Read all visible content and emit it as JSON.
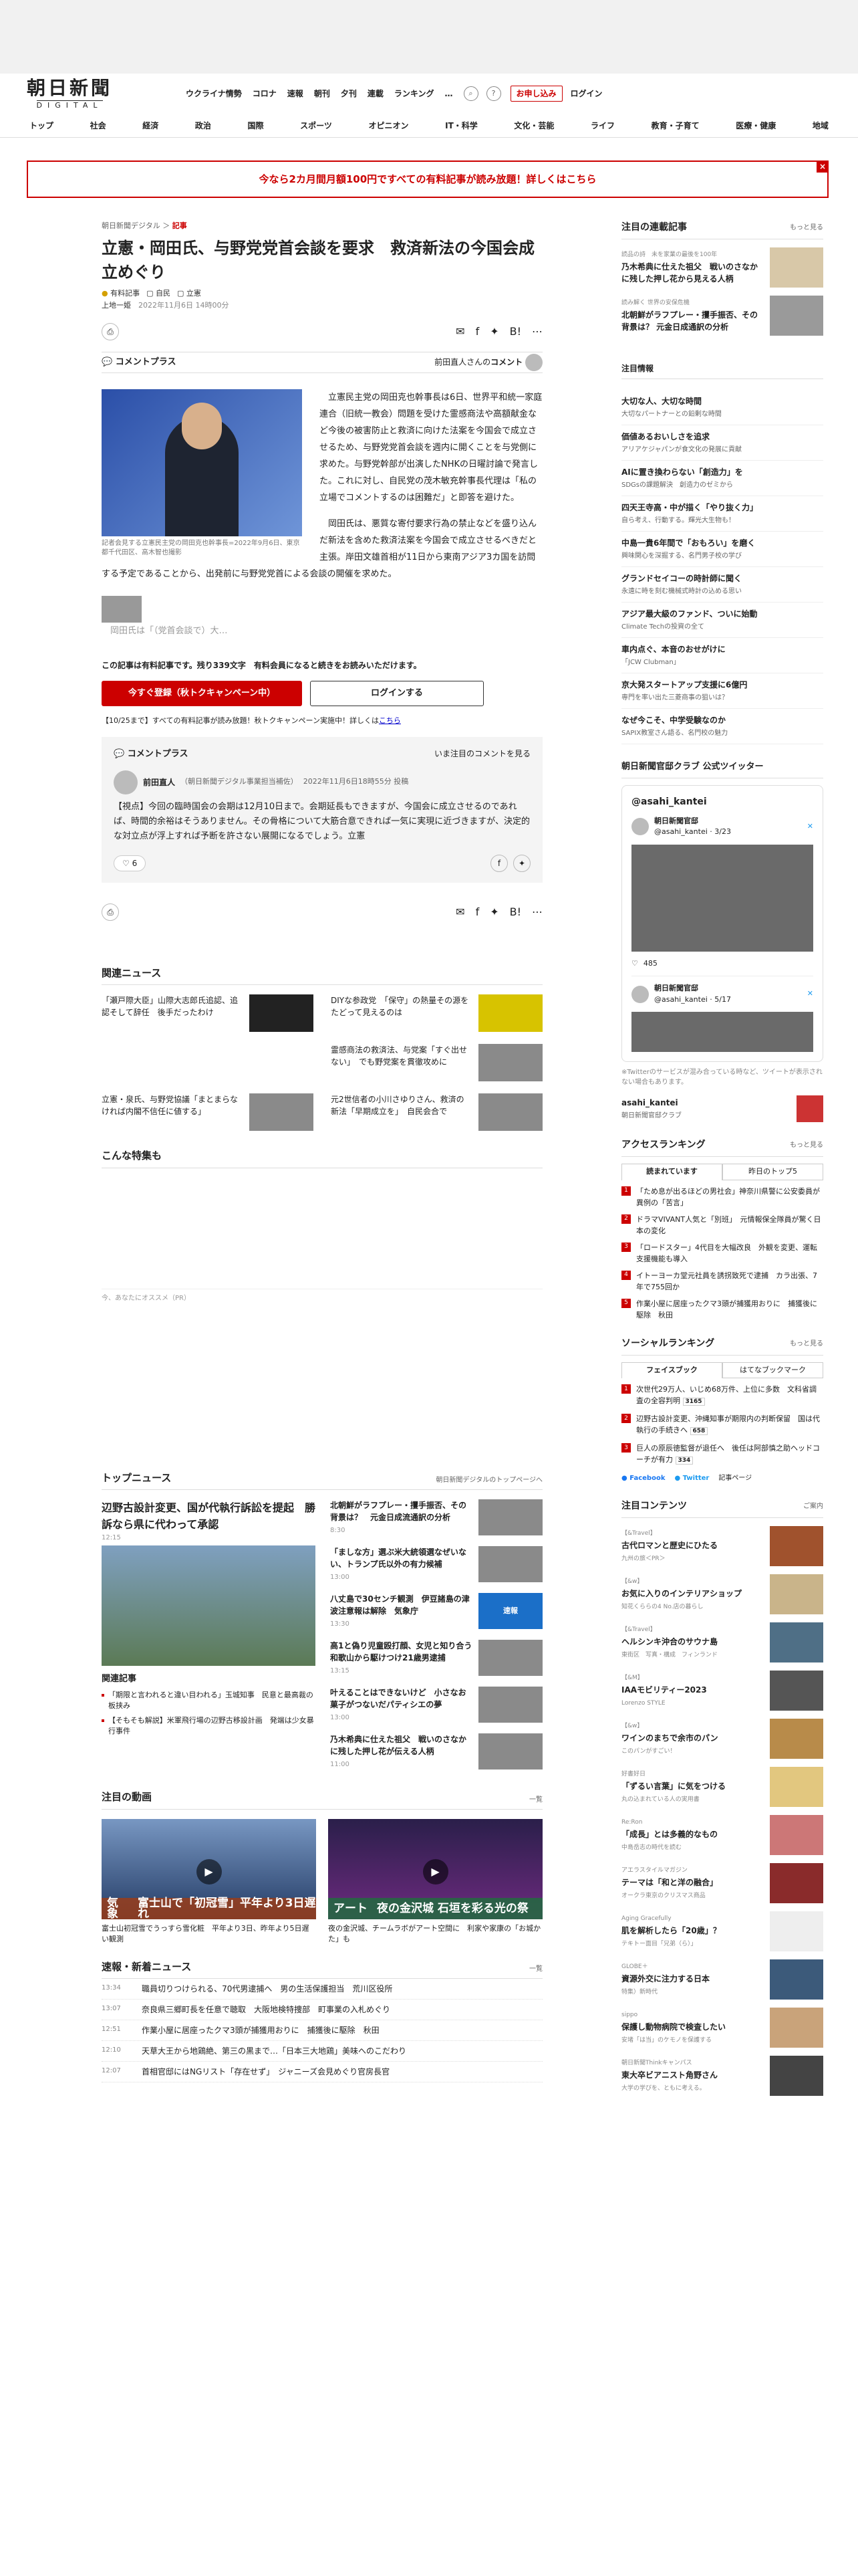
{
  "header": {
    "logo_main": "朝日新聞",
    "logo_sub": "DIGITAL",
    "nav": [
      "ウクライナ情勢",
      "コロナ",
      "速報",
      "朝刊",
      "夕刊",
      "連載",
      "ランキング"
    ],
    "more": "…",
    "subscribe": "お申し込み",
    "login": "ログイン"
  },
  "categories": [
    "トップ",
    "社会",
    "経済",
    "政治",
    "国際",
    "スポーツ",
    "オピニオン",
    "IT・科学",
    "文化・芸能",
    "ライフ",
    "教育・子育て",
    "医療・健康",
    "地域"
  ],
  "campaign": {
    "text": "今なら2カ月間月額100円ですべての有料記事が読み放題！詳しくはこちら",
    "close": "×"
  },
  "article": {
    "crumb_site": "朝日新聞デジタル",
    "crumb_sep": "＞",
    "crumb_cat": "記事",
    "title": "立憲・岡田氏、与野党党首会談を要求　救済新法の今国会成立めぐり",
    "paid": "有料記事",
    "tag1": "自民",
    "tag2": "立憲",
    "author": "上地一姫",
    "date": "2022年11月6日 14時00分",
    "comment_plus": "コメントプラス",
    "comment_by": "前田直人さんの",
    "comment_link": "コメント",
    "photo_caption": "記者会見する立憲民主党の岡田克也幹事長=2022年9月6日、東京都千代田区、高木智也撮影",
    "p1": "立憲民主党の岡田克也幹事長は6日、世界平和統一家庭連合（旧統一教会）問題を受けた霊感商法や高額献金など今後の被害防止と救済に向けた法案を今国会で成立させるため、与野党党首会談を週内に開くことを与党側に求めた。与野党幹部が出演したNHKの日曜討論で発言した。これに対し、自民党の茂木敏充幹事長代理は「私の立場でコメントするのは困難だ」と即答を避けた。",
    "p2": "岡田氏は、悪質な寄付要求行為の禁止などを盛り込んだ新法を含めた救済法案を今国会で成立させるべきだと主張。岸田文雄首相が11日から東南アジア3カ国を訪問する予定であることから、出発前に与野党党首による会談の開催を求めた。",
    "p3": "岡田氏は「（党首会談で）大…",
    "pay_lead": "この記事は有料記事です。残り339文字　有料会員になると続きをお読みいただけます。",
    "pay_primary": "今すぐ登録（秋トクキャンペーン中）",
    "pay_login": "ログインする",
    "notice": "【10/25まで】すべての有料記事が読み放題！秋トクキャンペーン実施中！詳しくは",
    "notice_link": "こちら"
  },
  "comment": {
    "title": "コメントプラス",
    "more": "いま注目のコメントを見る",
    "name": "前田直人",
    "role": "（朝日新聞デジタル事業担当補佐）",
    "date": "2022年11月6日18時55分 投稿",
    "text": "【視点】今回の臨時国会の会期は12月10日まで。会期延長もできますが、今国会に成立させるのであれば、時間的余裕はそうありません。その骨格について大筋合意できれば一気に実現に近づきますが、決定的な対立点が浮上すれば予断を許さない展開になるでしょう。立憲",
    "likes": "6"
  },
  "related": {
    "title": "関連ニュース",
    "items": [
      "「瀬戸際大臣」山際大志郎氏追認、追認そして辞任　後手だったわけ",
      "DIYな参政党　「保守」の熱量その源をたどって見えるのは",
      "霊感商法の救済法、与党案「すぐ出せない」　でも野党案を貫徹攻めに",
      "立憲・泉氏、与野党協議「まとまらなければ内閣不信任に値する」",
      "元2世信者の小川さゆりさん、救済の新法「早期成立を」　自民会合で"
    ],
    "features": "こんな特集も",
    "ad": "今、あなたにオススメ（PR）"
  },
  "topnews": {
    "title": "トップニュース",
    "link": "朝日新聞デジタルのトップページへ",
    "lead": "辺野古設計変更、国が代執行訴訟を提起　勝訴なら県に代わって承認",
    "lead_time": "12:15",
    "rel_title": "関連記事",
    "rel": [
      "「期限と言われると違い目われる」玉城知事　民意と最高裁の板挟み",
      "【そもそも解説】米軍飛行場の辺野古移設計画　発端は少女暴行事件"
    ],
    "items": [
      {
        "t": "北朝鮮がラフプレー・攫手振否、その背景は？　元金日成流通訳の分析",
        "tm": "8:30"
      },
      {
        "t": "「ましな方」選ぶ米大統領選なぜいない、トランプ氏以外の有力候補",
        "tm": "13:00"
      },
      {
        "t": "八丈島で30センチ観測　伊豆諸島の津波注意報は解除　気象庁",
        "tm": "13:30"
      },
      {
        "t": "高1と偽り児童殴打顔、女児と知り合う　和歌山から駆けつけ21歳男逮捕",
        "tm": "13:15"
      },
      {
        "t": "叶えることはできないけど　小さなお菓子がつないだパティシエの夢",
        "tm": "13:00"
      },
      {
        "t": "乃木希典に仕えた祖父　戦いのさなかに残した押し花が伝える人柄",
        "tm": "11:00"
      }
    ],
    "badge_news": "速報"
  },
  "video": {
    "title": "注目の動画",
    "more": "一覧",
    "v1_tag": "気象",
    "v1_band": "富士山で「初冠雪」平年より3日遅れ",
    "v1_cap": "富士山初冠雪でうっすら雪化粧　平年より3日、昨年より5日遅い観測",
    "v2_tag": "アート",
    "v2_band": "夜の金沢城 石垣を彩る光の祭",
    "v2_cap": "夜の金沢城、チームラボがアート空間に　利家や家康の「お城かた」も"
  },
  "flash": {
    "title": "速報・新着ニュース",
    "more": "一覧",
    "items": [
      {
        "tm": "13:34",
        "t": "職員切りつけられる、70代男逮捕へ　男の生活保護担当　荒川区役所"
      },
      {
        "tm": "13:07",
        "t": "奈良県三郷町長を任意で聴取　大阪地検特捜部　町事業の入札めぐり"
      },
      {
        "tm": "12:51",
        "t": "作業小屋に居座ったクマ3頭が捕獲用おりに　捕獲後に駆除　秋田"
      },
      {
        "tm": "12:10",
        "t": "天草大王から地鶏絶、第三の黒まで…「日本三大地鶏」美味へのこだわり"
      },
      {
        "tm": "12:07",
        "t": "首相官邸にはNGリスト「存在せず」　ジャニーズ会見めぐり官房長官"
      }
    ]
  },
  "sidebar": {
    "series_title": "注目の連載記事",
    "more": "もっと見る",
    "series": [
      {
        "cat": "読品の詩　未を家業の最後を100年",
        "t": "乃木希典に仕えた祖父　戦いのさなかに残した押し花から見える人柄"
      },
      {
        "cat": "読み解く 世界の安保危機",
        "t": "北朝鮮がラフプレー・攫手振否、その背景は？ 元金日成通訳の分析"
      }
    ],
    "attention_title": "注目情報",
    "attention": [
      {
        "t": "大切な人、大切な時間",
        "s": "大切なパートナーとの鉛剰な時間"
      },
      {
        "t": "価値あるおいしさを追求",
        "s": "アリアケジャパンが食文化の発展に貢献"
      },
      {
        "t": "AIに置き換わらない「創造力」を",
        "s": "SDGsの課題解決　創造力のゼミから"
      },
      {
        "t": "四天王寺高・中が描く「やり抜く力」",
        "s": "自ら考え、行動する。輝光大生物も！"
      },
      {
        "t": "中島一貴6年間で「おもろい」を磨く",
        "s": "興味関心を深掘する、名門男子校の学び"
      },
      {
        "t": "グランドセイコーの時計師に聞く",
        "s": "永遠に時を刻む機械式時計の込める思い"
      },
      {
        "t": "アジア最大級のファンド、ついに始動",
        "s": "Climate Techの投資の全て"
      },
      {
        "t": "車内点ぐ、本音のおせがけに",
        "s": "「JCW Clubman」"
      },
      {
        "t": "京大発スタートアップ支援に6億円",
        "s": "専門を率い出た三菱商事の狙いは？"
      },
      {
        "t": "なぜ今こそ、中学受験なのか",
        "s": "SAPIX教室さん語る、名門校の魅力"
      }
    ],
    "twitter_title": "朝日新聞官邸クラブ 公式ツイッター",
    "tw_handle": "@asahi_kantei",
    "tw_name": "朝日新聞官邸",
    "tw_date1": "3/23",
    "tw_date2": "5/17",
    "tw_counts": "485",
    "tw_note": "※Twitterのサービスが混み合っている時など、ツイートが表示されない場合もあります。",
    "tw_footer_name": "asahi_kantei",
    "tw_footer_sub": "朝日新聞官邸クラブ",
    "ranking_title": "アクセスランキング",
    "rank_tab1": "読まれています",
    "rank_tab2": "昨日のトップ5",
    "ranking": [
      "「ため息が出るほどの男社会」神奈川県警に公安委員が異例の「苦言」",
      "ドラマVIVANT人気と「別班」　元情報保全隊員が驚く日本の変化",
      "「ロードスター」4代目を大幅改良　外観を変更、運転支援機能も導入",
      "イトーヨーカ堂元社員を誘拐致死で逮捕　カラ出張、7年で755回か",
      "作業小屋に居座ったクマ3頭が捕獲用おりに　捕獲後に駆除　秋田"
    ],
    "social_title": "ソーシャルランキング",
    "social_tab1": "フェイスブック",
    "social_tab2": "はてなブックマーク",
    "social": [
      "次世代29万人、いじめ68万件、上位に多数　文科省調査の全容判明",
      "辺野古設計変更、沖縄知事が期限内の判断保留　国は代執行の手続きへ",
      "巨人の原辰徳監督が退任へ　後任は阿部慎之助ヘッドコーチが有力"
    ],
    "social_counts": [
      "3165",
      "658",
      "334"
    ],
    "fb": "Facebook",
    "tw": "Twitter",
    "social_more": "記事ページ",
    "contents_title": "注目コンテンツ",
    "contents_more": "ご案内",
    "contents": [
      {
        "c": "【&Travel】",
        "t": "古代ロマンと歴史にひたる",
        "s": "九州の旅＜PR＞"
      },
      {
        "c": "【&w】",
        "t": "お気に入りのインテリアショップ",
        "s": "知花くららの4 No.店の暮らし"
      },
      {
        "c": "【&Travel】",
        "t": "ヘルシンキ沖合のサウナ島",
        "s": "東街区　写真・構成　フィンランド"
      },
      {
        "c": "【&M】",
        "t": "IAAモビリティー2023",
        "s": "Lorenzo STYLE"
      },
      {
        "c": "【&w】",
        "t": "ワインのまちで余市のパン",
        "s": "このパンがすごい！"
      },
      {
        "c": "好書好日",
        "t": "「ずるい言葉」に気をつける",
        "s": "丸の込まれている人の実用書"
      },
      {
        "c": "Re:Ron",
        "t": "「成長」とは多義的なもの",
        "s": "中島岳志の時代を読む"
      },
      {
        "c": "アエラスタイルマガジン",
        "t": "テーマは「和と洋の融合」",
        "s": "オークラ東京のクリスマス商品"
      },
      {
        "c": "Aging Gracefully",
        "t": "肌を解析したら「20歳」？",
        "s": "テキトー面目「兄弟（ら）」"
      },
      {
        "c": "GLOBE＋",
        "t": "資源外交に注力する日本",
        "s": "特集）新時代"
      },
      {
        "c": "sippo",
        "t": "保護し動物病院で検査したい",
        "s": "安堵「は当」のケモノを保護する"
      },
      {
        "c": "朝日新聞Thinkキャンパス",
        "t": "東大卒ビアニスト角野さん",
        "s": "大学の学びを、ともに考える。"
      }
    ]
  }
}
